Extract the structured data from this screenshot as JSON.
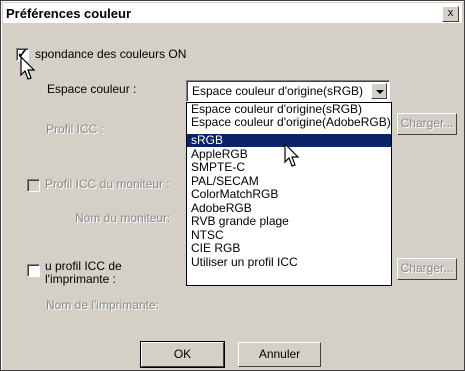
{
  "window": {
    "title": "Préférences couleur",
    "close_label": "x"
  },
  "color_matching": {
    "checkbox_label": "spondance des couleurs ON",
    "checked": true
  },
  "color_space": {
    "label": "Espace couleur :",
    "selected_value": "Espace couleur d'origine(sRGB)",
    "options": [
      "Espace couleur d'origine(sRGB)",
      "Espace couleur d'origine(AdobeRGB)",
      "sRGB",
      "AppleRGB",
      "SMPTE-C",
      "PAL/SECAM",
      "ColorMatchRGB",
      "AdobeRGB",
      "RVB grande plage",
      "NTSC",
      "CIE RGB",
      "Utiliser un profil ICC"
    ],
    "highlighted_option": "sRGB"
  },
  "icc_profile": {
    "label": "Profil ICC :",
    "load_label": "Charger..."
  },
  "monitor": {
    "checkbox_label": "Profil ICC du moniteur :",
    "name_label": "Nom du moniteur:"
  },
  "printer": {
    "checkbox_label_line1": "u profil ICC de",
    "checkbox_label_line2": "l'imprimante :",
    "load_label": "Charger...",
    "name_label": "Nom de l'imprimante:"
  },
  "buttons": {
    "ok_label": "OK",
    "cancel_label": "Annuler"
  }
}
